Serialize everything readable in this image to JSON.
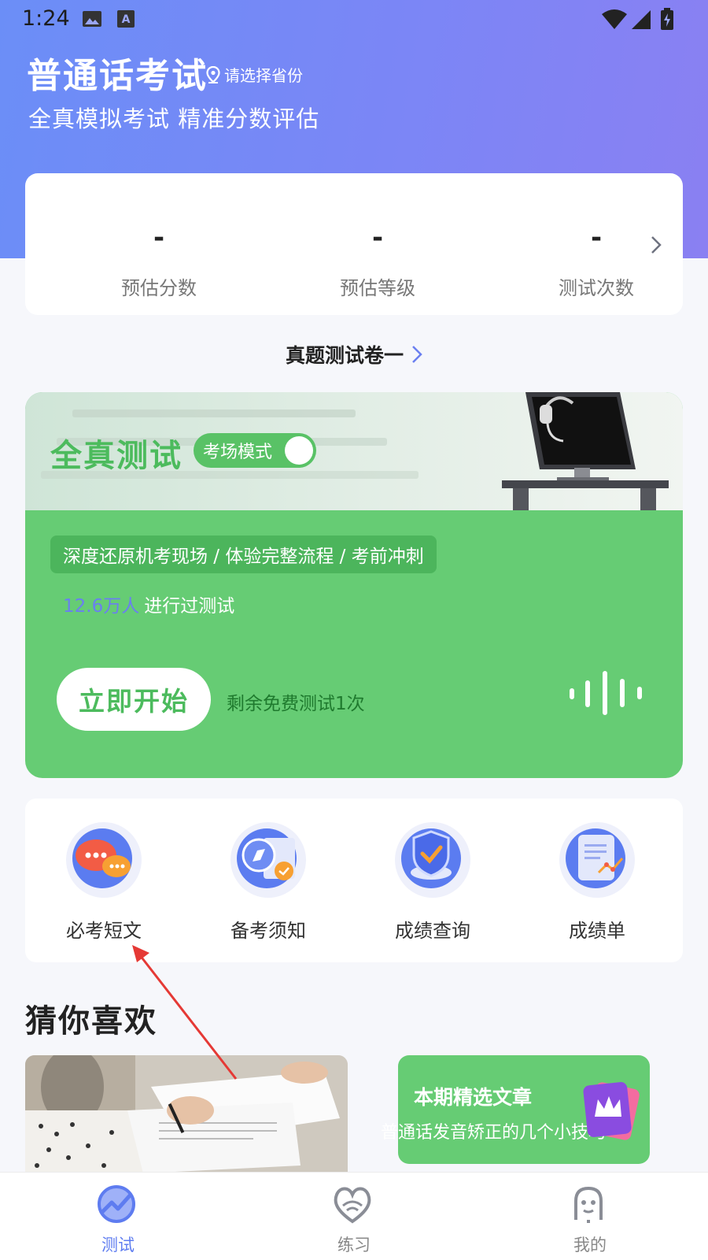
{
  "status_bar": {
    "time": "1:24"
  },
  "header": {
    "title": "普通话考试",
    "province_label": "请选择省份",
    "subtitle": "全真模拟考试 精准分数评估"
  },
  "stats": [
    {
      "value": "-",
      "label": "预估分数"
    },
    {
      "value": "-",
      "label": "预估等级"
    },
    {
      "value": "-",
      "label": "测试次数"
    }
  ],
  "paper_link": "真题测试卷一",
  "exam_card": {
    "title": "全真测试",
    "mode_label": "考场模式",
    "mode_on": true,
    "features": "深度还原机考现场 / 体验完整流程 / 考前冲刺",
    "user_count": "12.6万人",
    "user_count_suffix": "进行过测试",
    "start_label": "立即开始",
    "free_remaining": "剩余免费测试1次"
  },
  "tools": [
    {
      "label": "必考短文",
      "icon": "chat-bubbles-icon"
    },
    {
      "label": "备考须知",
      "icon": "compass-book-icon"
    },
    {
      "label": "成绩查询",
      "icon": "shield-check-icon"
    },
    {
      "label": "成绩单",
      "icon": "report-scroll-icon"
    }
  ],
  "recommend": {
    "title": "猜你喜欢",
    "article_title": "本期精选文章",
    "article_subtitle": "普通话发音矫正的几个小技巧"
  },
  "bottom_nav": [
    {
      "label": "测试",
      "active": true
    },
    {
      "label": "练习",
      "active": false
    },
    {
      "label": "我的",
      "active": false
    }
  ],
  "colors": {
    "primary": "#6b8ef7",
    "green": "#66cc74",
    "accent_blue": "#5e7cf0",
    "annotation_red": "#e53935"
  }
}
